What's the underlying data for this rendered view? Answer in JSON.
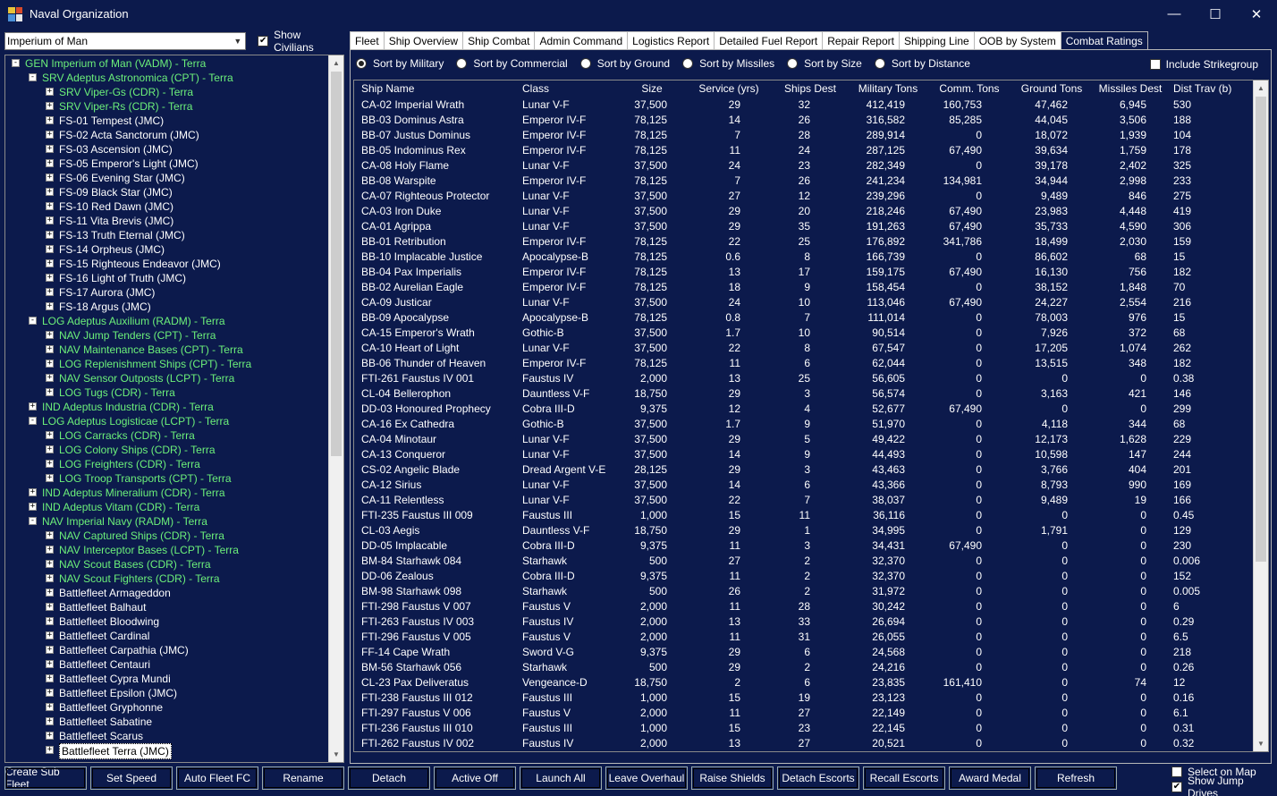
{
  "window": {
    "title": "Naval Organization"
  },
  "left": {
    "race_value": "Imperium of Man",
    "show_civilians_label": "Show Civilians",
    "show_civilians_checked": true,
    "tree": [
      {
        "level": 0,
        "exp": "-",
        "label": "GEN Imperium of Man  (VADM)  -  Terra",
        "color": "green"
      },
      {
        "level": 1,
        "exp": "-",
        "label": "SRV Adeptus Astronomica  (CPT)  -  Terra",
        "color": "green"
      },
      {
        "level": 2,
        "exp": "+",
        "label": "SRV Viper-Gs  (CDR)  -  Terra",
        "color": "green"
      },
      {
        "level": 2,
        "exp": "+",
        "label": "SRV Viper-Rs  (CDR)  -  Terra",
        "color": "green"
      },
      {
        "level": 2,
        "exp": "+",
        "label": "FS-01 Tempest  (JMC)",
        "color": "white"
      },
      {
        "level": 2,
        "exp": "+",
        "label": "FS-02 Acta Sanctorum  (JMC)",
        "color": "white"
      },
      {
        "level": 2,
        "exp": "+",
        "label": "FS-03 Ascension  (JMC)",
        "color": "white"
      },
      {
        "level": 2,
        "exp": "+",
        "label": "FS-05 Emperor's Light  (JMC)",
        "color": "white"
      },
      {
        "level": 2,
        "exp": "+",
        "label": "FS-06 Evening Star  (JMC)",
        "color": "white"
      },
      {
        "level": 2,
        "exp": "+",
        "label": "FS-09 Black Star  (JMC)",
        "color": "white"
      },
      {
        "level": 2,
        "exp": "+",
        "label": "FS-10 Red Dawn  (JMC)",
        "color": "white"
      },
      {
        "level": 2,
        "exp": "+",
        "label": "FS-11 Vita Brevis  (JMC)",
        "color": "white"
      },
      {
        "level": 2,
        "exp": "+",
        "label": "FS-13 Truth Eternal  (JMC)",
        "color": "white"
      },
      {
        "level": 2,
        "exp": "+",
        "label": "FS-14 Orpheus  (JMC)",
        "color": "white"
      },
      {
        "level": 2,
        "exp": "+",
        "label": "FS-15 Righteous Endeavor  (JMC)",
        "color": "white"
      },
      {
        "level": 2,
        "exp": "+",
        "label": "FS-16 Light of Truth  (JMC)",
        "color": "white"
      },
      {
        "level": 2,
        "exp": "+",
        "label": "FS-17 Aurora  (JMC)",
        "color": "white"
      },
      {
        "level": 2,
        "exp": "+",
        "label": "FS-18 Argus  (JMC)",
        "color": "white"
      },
      {
        "level": 1,
        "exp": "-",
        "label": "LOG Adeptus Auxilium  (RADM)  -  Terra",
        "color": "green"
      },
      {
        "level": 2,
        "exp": "+",
        "label": "NAV Jump Tenders  (CPT)  -  Terra",
        "color": "green"
      },
      {
        "level": 2,
        "exp": "+",
        "label": "NAV Maintenance Bases  (CPT)  -  Terra",
        "color": "green"
      },
      {
        "level": 2,
        "exp": "+",
        "label": "LOG Replenishment Ships  (CPT)  -  Terra",
        "color": "green"
      },
      {
        "level": 2,
        "exp": "+",
        "label": "NAV Sensor Outposts  (LCPT)  -  Terra",
        "color": "green"
      },
      {
        "level": 2,
        "exp": "+",
        "label": "LOG Tugs  (CDR)  -  Terra",
        "color": "green"
      },
      {
        "level": 1,
        "exp": "+",
        "label": "IND Adeptus Industria  (CDR)  -  Terra",
        "color": "green"
      },
      {
        "level": 1,
        "exp": "-",
        "label": "LOG Adeptus Logisticae  (LCPT)  -  Terra",
        "color": "green"
      },
      {
        "level": 2,
        "exp": "+",
        "label": "LOG Carracks  (CDR)  -  Terra",
        "color": "green"
      },
      {
        "level": 2,
        "exp": "+",
        "label": "LOG Colony Ships  (CDR)  -  Terra",
        "color": "green"
      },
      {
        "level": 2,
        "exp": "+",
        "label": "LOG Freighters  (CDR)  -  Terra",
        "color": "green"
      },
      {
        "level": 2,
        "exp": "+",
        "label": "LOG Troop Transports  (CPT)  -  Terra",
        "color": "green"
      },
      {
        "level": 1,
        "exp": "+",
        "label": "IND Adeptus Mineralium  (CDR)  -  Terra",
        "color": "green"
      },
      {
        "level": 1,
        "exp": "+",
        "label": "IND Adeptus Vitam  (CDR)  -  Terra",
        "color": "green"
      },
      {
        "level": 1,
        "exp": "-",
        "label": "NAV Imperial Navy  (RADM)  -  Terra",
        "color": "green"
      },
      {
        "level": 2,
        "exp": "+",
        "label": "NAV Captured Ships  (CDR)  -  Terra",
        "color": "green"
      },
      {
        "level": 2,
        "exp": "+",
        "label": "NAV Interceptor Bases  (LCPT)  -  Terra",
        "color": "green"
      },
      {
        "level": 2,
        "exp": "+",
        "label": "NAV Scout Bases  (CDR)  -  Terra",
        "color": "green"
      },
      {
        "level": 2,
        "exp": "+",
        "label": "NAV Scout Fighters  (CDR)  -  Terra",
        "color": "green"
      },
      {
        "level": 2,
        "exp": "+",
        "label": "Battlefleet Armageddon",
        "color": "white"
      },
      {
        "level": 2,
        "exp": "+",
        "label": "Battlefleet Balhaut",
        "color": "white"
      },
      {
        "level": 2,
        "exp": "+",
        "label": "Battlefleet Bloodwing",
        "color": "white"
      },
      {
        "level": 2,
        "exp": "+",
        "label": "Battlefleet Cardinal",
        "color": "white"
      },
      {
        "level": 2,
        "exp": "+",
        "label": "Battlefleet Carpathia  (JMC)",
        "color": "white"
      },
      {
        "level": 2,
        "exp": "+",
        "label": "Battlefleet Centauri",
        "color": "white"
      },
      {
        "level": 2,
        "exp": "+",
        "label": "Battlefleet Cypra Mundi",
        "color": "white"
      },
      {
        "level": 2,
        "exp": "+",
        "label": "Battlefleet Epsilon  (JMC)",
        "color": "white"
      },
      {
        "level": 2,
        "exp": "+",
        "label": "Battlefleet Gryphonne",
        "color": "white"
      },
      {
        "level": 2,
        "exp": "+",
        "label": "Battlefleet Sabatine",
        "color": "white"
      },
      {
        "level": 2,
        "exp": "+",
        "label": "Battlefleet Scarus",
        "color": "white"
      },
      {
        "level": 2,
        "exp": "+",
        "label": "Battlefleet Terra  (JMC)",
        "color": "white",
        "selected": true
      }
    ]
  },
  "tabs": [
    "Fleet",
    "Ship Overview",
    "Ship Combat",
    "Admin Command",
    "Logistics Report",
    "Detailed Fuel Report",
    "Repair Report",
    "Shipping Line",
    "OOB by System",
    "Combat Ratings"
  ],
  "active_tab": "Combat Ratings",
  "sort_options": [
    {
      "label": "Sort by Military",
      "checked": true
    },
    {
      "label": "Sort by Commercial",
      "checked": false
    },
    {
      "label": "Sort by Ground",
      "checked": false
    },
    {
      "label": "Sort by Missiles",
      "checked": false
    },
    {
      "label": "Sort by Size",
      "checked": false
    },
    {
      "label": "Sort by Distance",
      "checked": false
    }
  ],
  "include_strikegroup_label": "Include Strikegroup",
  "table": {
    "columns": [
      "Ship Name",
      "Class",
      "Size",
      "Service (yrs)",
      "Ships Dest",
      "Military Tons",
      "Comm. Tons",
      "Ground Tons",
      "Missiles Dest",
      "Dist Trav (b)"
    ],
    "rows": [
      [
        "CA-02 Imperial Wrath",
        "Lunar V-F",
        "37,500",
        "29",
        "32",
        "412,419",
        "160,753",
        "47,462",
        "6,945",
        "530"
      ],
      [
        "BB-03 Dominus Astra",
        "Emperor IV-F",
        "78,125",
        "14",
        "26",
        "316,582",
        "85,285",
        "44,045",
        "3,506",
        "188"
      ],
      [
        "BB-07 Justus Dominus",
        "Emperor IV-F",
        "78,125",
        "7",
        "28",
        "289,914",
        "0",
        "18,072",
        "1,939",
        "104"
      ],
      [
        "BB-05 Indominus Rex",
        "Emperor IV-F",
        "78,125",
        "11",
        "24",
        "287,125",
        "67,490",
        "39,634",
        "1,759",
        "178"
      ],
      [
        "CA-08 Holy Flame",
        "Lunar V-F",
        "37,500",
        "24",
        "23",
        "282,349",
        "0",
        "39,178",
        "2,402",
        "325"
      ],
      [
        "BB-08 Warspite",
        "Emperor IV-F",
        "78,125",
        "7",
        "26",
        "241,234",
        "134,981",
        "34,944",
        "2,998",
        "233"
      ],
      [
        "CA-07 Righteous Protector",
        "Lunar V-F",
        "37,500",
        "27",
        "12",
        "239,296",
        "0",
        "9,489",
        "846",
        "275"
      ],
      [
        "CA-03 Iron Duke",
        "Lunar V-F",
        "37,500",
        "29",
        "20",
        "218,246",
        "67,490",
        "23,983",
        "4,448",
        "419"
      ],
      [
        "CA-01 Agrippa",
        "Lunar V-F",
        "37,500",
        "29",
        "35",
        "191,263",
        "67,490",
        "35,733",
        "4,590",
        "306"
      ],
      [
        "BB-01 Retribution",
        "Emperor IV-F",
        "78,125",
        "22",
        "25",
        "176,892",
        "341,786",
        "18,499",
        "2,030",
        "159"
      ],
      [
        "BB-10 Implacable Justice",
        "Apocalypse-B",
        "78,125",
        "0.6",
        "8",
        "166,739",
        "0",
        "86,602",
        "68",
        "15"
      ],
      [
        "BB-04 Pax Imperialis",
        "Emperor IV-F",
        "78,125",
        "13",
        "17",
        "159,175",
        "67,490",
        "16,130",
        "756",
        "182"
      ],
      [
        "BB-02 Aurelian Eagle",
        "Emperor IV-F",
        "78,125",
        "18",
        "9",
        "158,454",
        "0",
        "38,152",
        "1,848",
        "70"
      ],
      [
        "CA-09 Justicar",
        "Lunar V-F",
        "37,500",
        "24",
        "10",
        "113,046",
        "67,490",
        "24,227",
        "2,554",
        "216"
      ],
      [
        "BB-09 Apocalypse",
        "Apocalypse-B",
        "78,125",
        "0.8",
        "7",
        "111,014",
        "0",
        "78,003",
        "976",
        "15"
      ],
      [
        "CA-15 Emperor's Wrath",
        "Gothic-B",
        "37,500",
        "1.7",
        "10",
        "90,514",
        "0",
        "7,926",
        "372",
        "68"
      ],
      [
        "CA-10 Heart of Light",
        "Lunar V-F",
        "37,500",
        "22",
        "8",
        "67,547",
        "0",
        "17,205",
        "1,074",
        "262"
      ],
      [
        "BB-06 Thunder of Heaven",
        "Emperor IV-F",
        "78,125",
        "11",
        "6",
        "62,044",
        "0",
        "13,515",
        "348",
        "182"
      ],
      [
        "FTI-261 Faustus IV 001",
        "Faustus IV",
        "2,000",
        "13",
        "25",
        "56,605",
        "0",
        "0",
        "0",
        "0.38"
      ],
      [
        "CL-04 Bellerophon",
        "Dauntless V-F",
        "18,750",
        "29",
        "3",
        "56,574",
        "0",
        "3,163",
        "421",
        "146"
      ],
      [
        "DD-03 Honoured Prophecy",
        "Cobra III-D",
        "9,375",
        "12",
        "4",
        "52,677",
        "67,490",
        "0",
        "0",
        "299"
      ],
      [
        "CA-16 Ex Cathedra",
        "Gothic-B",
        "37,500",
        "1.7",
        "9",
        "51,970",
        "0",
        "4,118",
        "344",
        "68"
      ],
      [
        "CA-04 Minotaur",
        "Lunar V-F",
        "37,500",
        "29",
        "5",
        "49,422",
        "0",
        "12,173",
        "1,628",
        "229"
      ],
      [
        "CA-13 Conqueror",
        "Lunar V-F",
        "37,500",
        "14",
        "9",
        "44,493",
        "0",
        "10,598",
        "147",
        "244"
      ],
      [
        "CS-02 Angelic Blade",
        "Dread Argent V-E",
        "28,125",
        "29",
        "3",
        "43,463",
        "0",
        "3,766",
        "404",
        "201"
      ],
      [
        "CA-12 Sirius",
        "Lunar V-F",
        "37,500",
        "14",
        "6",
        "43,366",
        "0",
        "8,793",
        "990",
        "169"
      ],
      [
        "CA-11 Relentless",
        "Lunar V-F",
        "37,500",
        "22",
        "7",
        "38,037",
        "0",
        "9,489",
        "19",
        "166"
      ],
      [
        "FTI-235 Faustus III 009",
        "Faustus III",
        "1,000",
        "15",
        "11",
        "36,116",
        "0",
        "0",
        "0",
        "0.45"
      ],
      [
        "CL-03 Aegis",
        "Dauntless V-F",
        "18,750",
        "29",
        "1",
        "34,995",
        "0",
        "1,791",
        "0",
        "129"
      ],
      [
        "DD-05 Implacable",
        "Cobra III-D",
        "9,375",
        "11",
        "3",
        "34,431",
        "67,490",
        "0",
        "0",
        "230"
      ],
      [
        "BM-84 Starhawk 084",
        "Starhawk",
        "500",
        "27",
        "2",
        "32,370",
        "0",
        "0",
        "0",
        "0.006"
      ],
      [
        "DD-06 Zealous",
        "Cobra III-D",
        "9,375",
        "11",
        "2",
        "32,370",
        "0",
        "0",
        "0",
        "152"
      ],
      [
        "BM-98 Starhawk 098",
        "Starhawk",
        "500",
        "26",
        "2",
        "31,972",
        "0",
        "0",
        "0",
        "0.005"
      ],
      [
        "FTI-298 Faustus V 007",
        "Faustus V",
        "2,000",
        "11",
        "28",
        "30,242",
        "0",
        "0",
        "0",
        "6"
      ],
      [
        "FTI-263 Faustus IV 003",
        "Faustus IV",
        "2,000",
        "13",
        "33",
        "26,694",
        "0",
        "0",
        "0",
        "0.29"
      ],
      [
        "FTI-296 Faustus V 005",
        "Faustus V",
        "2,000",
        "11",
        "31",
        "26,055",
        "0",
        "0",
        "0",
        "6.5"
      ],
      [
        "FF-14 Cape Wrath",
        "Sword V-G",
        "9,375",
        "29",
        "6",
        "24,568",
        "0",
        "0",
        "0",
        "218"
      ],
      [
        "BM-56 Starhawk 056",
        "Starhawk",
        "500",
        "29",
        "2",
        "24,216",
        "0",
        "0",
        "0",
        "0.26"
      ],
      [
        "CL-23 Pax Deliveratus",
        "Vengeance-D",
        "18,750",
        "2",
        "6",
        "23,835",
        "161,410",
        "0",
        "74",
        "12"
      ],
      [
        "FTI-238 Faustus III 012",
        "Faustus III",
        "1,000",
        "15",
        "19",
        "23,123",
        "0",
        "0",
        "0",
        "0.16"
      ],
      [
        "FTI-297 Faustus V 006",
        "Faustus V",
        "2,000",
        "11",
        "27",
        "22,149",
        "0",
        "0",
        "0",
        "6.1"
      ],
      [
        "FTI-236 Faustus III 010",
        "Faustus III",
        "1,000",
        "15",
        "23",
        "22,145",
        "0",
        "0",
        "0",
        "0.31"
      ],
      [
        "FTI-262 Faustus IV 002",
        "Faustus IV",
        "2,000",
        "13",
        "27",
        "20,521",
        "0",
        "0",
        "0",
        "0.32"
      ]
    ]
  },
  "buttons": [
    "Create Sub Fleet",
    "Set Speed",
    "Auto Fleet FC",
    "Rename",
    "Detach",
    "Active Off",
    "Launch All",
    "Leave Overhaul",
    "Raise Shields",
    "Detach Escorts",
    "Recall Escorts",
    "Award Medal",
    "Refresh"
  ],
  "bottom_checks": [
    {
      "label": "Select on Map",
      "checked": false
    },
    {
      "label": "Show Jump Drives",
      "checked": true
    }
  ]
}
